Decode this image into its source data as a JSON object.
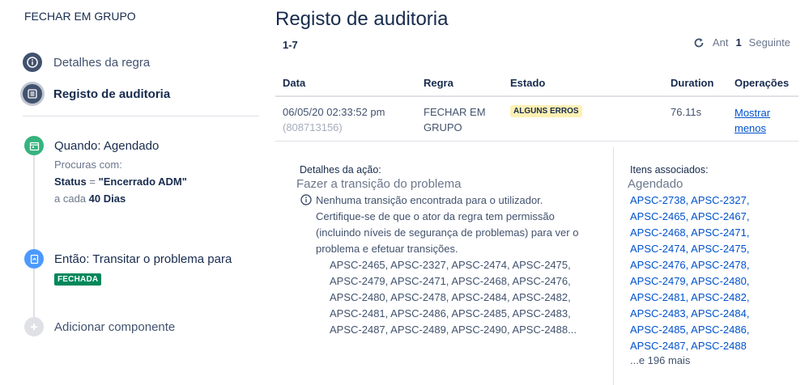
{
  "sidebar": {
    "rule_name": "FECHAR EM GRUPO",
    "nav": [
      {
        "label": "Detalhes da regra",
        "icon": "info-icon"
      },
      {
        "label": "Registo de auditoria",
        "icon": "list-icon"
      }
    ],
    "trigger": {
      "title": "Quando: Agendado",
      "search_label": "Procuras com:",
      "status_key": "Status",
      "status_eq": " = ",
      "status_value": "\"Encerrado ADM\"",
      "every_prefix": "a cada ",
      "every_value": "40 Dias",
      "icon": "calendar-icon",
      "color": "#36b37e"
    },
    "action": {
      "title": "Então: Transitar o problema para",
      "status": "FECHADA",
      "status_color": "#00875a",
      "icon": "transition-icon",
      "color": "#4c9aff"
    },
    "add": {
      "label": "Adicionar componente",
      "icon": "plus-icon"
    }
  },
  "main": {
    "title": "Registo de auditoria",
    "range": "1-7",
    "pager": {
      "prev": "Ant",
      "current": "1",
      "next": "Seguinte",
      "refresh_icon": "refresh-icon"
    },
    "columns": {
      "date": "Data",
      "rule": "Regra",
      "state": "Estado",
      "duration": "Duration",
      "ops": "Operações"
    },
    "row": {
      "date": "06/05/20 02:33:52 pm",
      "id": "(808713156)",
      "rule_line1": "FECHAR EM",
      "rule_line2": "GRUPO",
      "state": "ALGUNS ERROS",
      "state_color": "#fff0b3",
      "duration": "76.11s",
      "op_line1": "Mostrar",
      "op_line2": "menos"
    },
    "details": {
      "label": "Detalhes da ação:",
      "action": "Fazer a transição do problema",
      "message_lines": [
        "Nenhuma transição encontrada para o utilizador.",
        "Certifique-se de que o ator da regra tem permissão",
        "(incluindo níveis de segurança de problemas) para ver o",
        "problema e efetuar transições."
      ],
      "issue_lines": [
        "APSC-2465, APSC-2327, APSC-2474, APSC-2475,",
        "APSC-2479, APSC-2471, APSC-2468, APSC-2476,",
        "APSC-2480, APSC-2478, APSC-2484, APSC-2482,",
        "APSC-2481, APSC-2486, APSC-2485, APSC-2483,",
        "APSC-2487, APSC-2489, APSC-2490, APSC-2488..."
      ]
    },
    "associated": {
      "label": "Itens associados:",
      "sub": "Agendado",
      "rows": [
        [
          "APSC-2738",
          "APSC-2327"
        ],
        [
          "APSC-2465",
          "APSC-2467"
        ],
        [
          "APSC-2468",
          "APSC-2471"
        ],
        [
          "APSC-2474",
          "APSC-2475"
        ],
        [
          "APSC-2476",
          "APSC-2478"
        ],
        [
          "APSC-2479",
          "APSC-2480"
        ],
        [
          "APSC-2481",
          "APSC-2482"
        ],
        [
          "APSC-2483",
          "APSC-2484"
        ],
        [
          "APSC-2485",
          "APSC-2486"
        ],
        [
          "APSC-2487",
          "APSC-2488"
        ]
      ],
      "more": "...e 196 mais"
    }
  }
}
